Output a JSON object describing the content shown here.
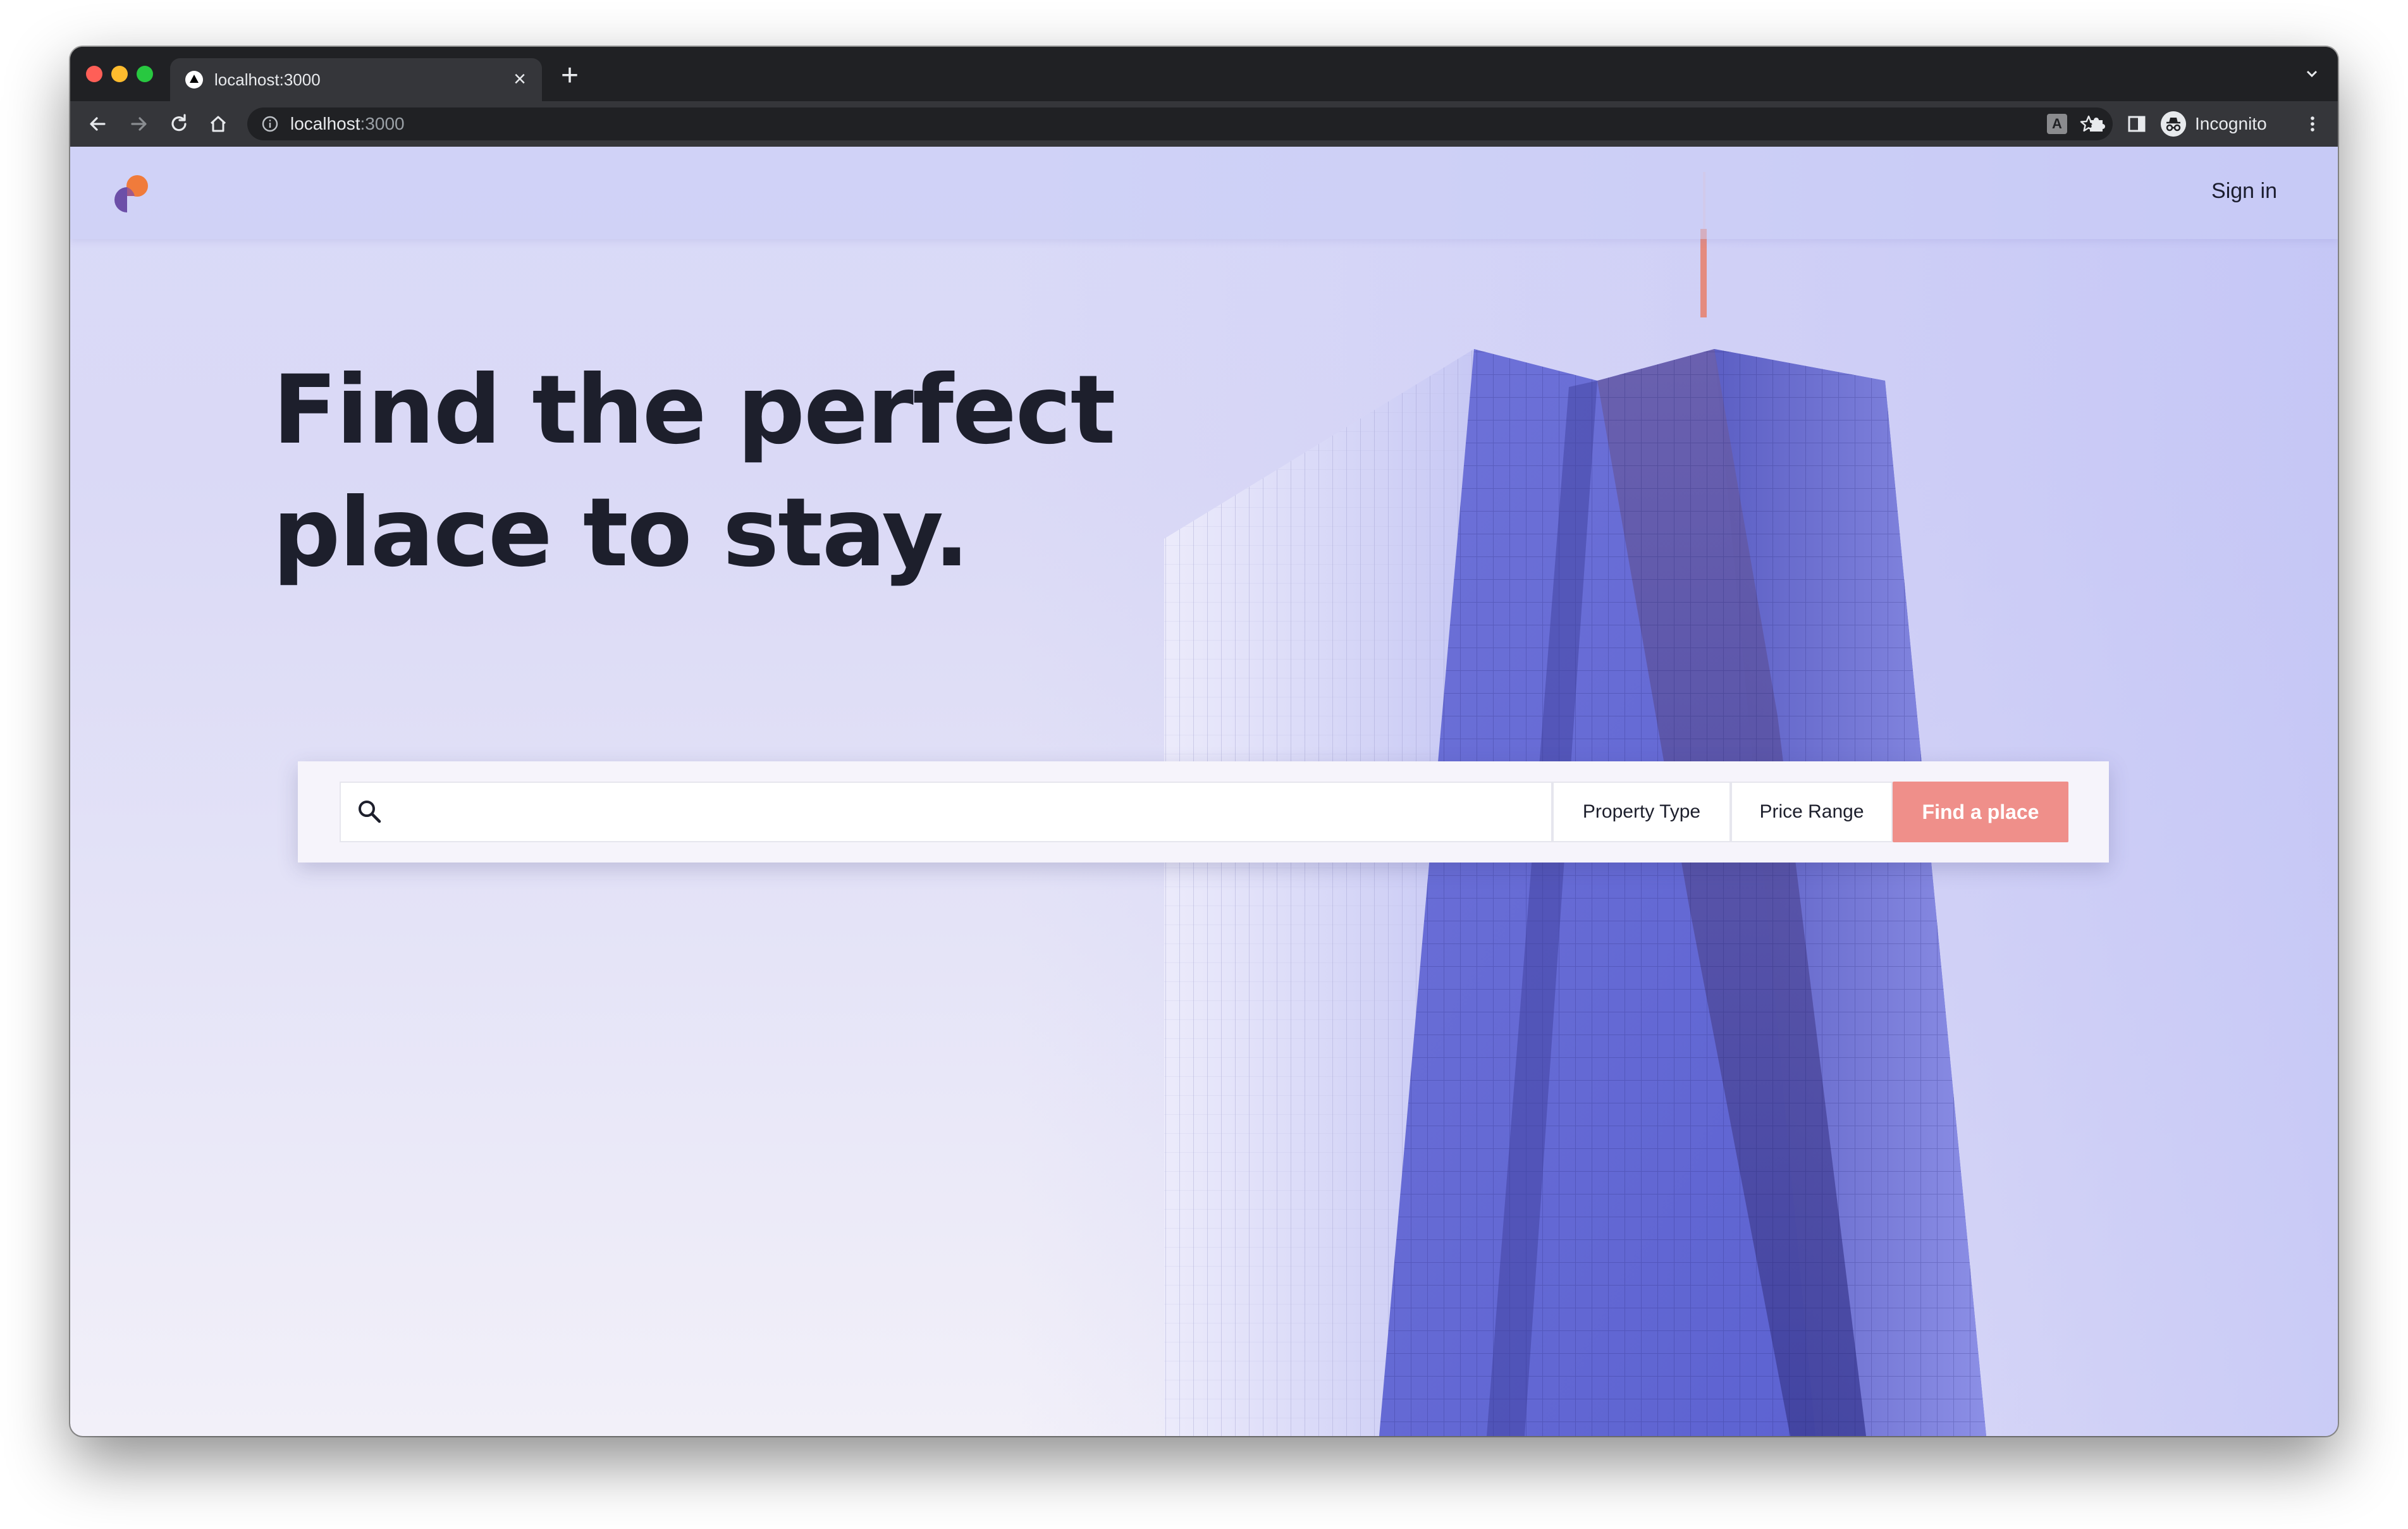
{
  "browser": {
    "tab": {
      "title": "localhost:3000",
      "close_symbol": "×"
    },
    "new_tab_symbol": "+",
    "address": {
      "host": "localhost",
      "port": ":3000"
    },
    "extension_badge": "A",
    "profile_label": "Incognito",
    "icons": {
      "back": "arrow-left-icon",
      "forward": "arrow-right-icon",
      "reload": "reload-icon",
      "home": "home-icon",
      "site_info": "info-icon",
      "bookmark": "star-icon",
      "extensions": "puzzle-icon",
      "side_panel": "side-panel-icon",
      "menu": "more-vert-icon",
      "tab_search": "chevron-down-icon"
    }
  },
  "site": {
    "sign_in": "Sign in",
    "headline_line1": "Find the perfect",
    "headline_line2": "place to stay.",
    "search": {
      "placeholder": "",
      "property_type": "Property Type",
      "price_range": "Price Range",
      "submit": "Find a place"
    }
  },
  "colors": {
    "accent": "#ef8f8a",
    "headline": "#1d1f2c",
    "logo_orange": "#f07b3b",
    "logo_purple": "#6c4fa8"
  }
}
